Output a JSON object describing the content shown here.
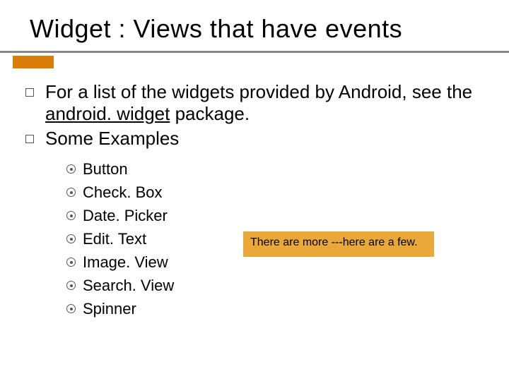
{
  "title": "Widget : Views that have events",
  "bullets": [
    {
      "pre": "For a list of the widgets provided by Android, see the ",
      "link": "android. widget",
      "post": " package."
    },
    {
      "text": "Some Examples"
    }
  ],
  "examples": [
    "Button",
    "Check. Box",
    "Date. Picker",
    "Edit. Text",
    "Image. View",
    "Search. View",
    "Spinner"
  ],
  "callout": "There are more ---here are a few."
}
